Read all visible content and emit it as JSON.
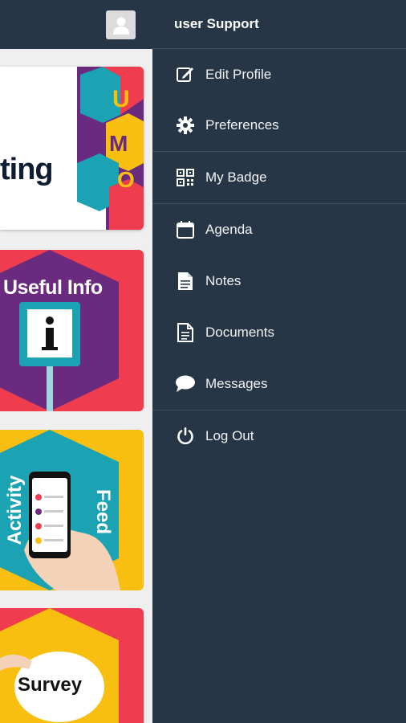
{
  "drawer": {
    "user_name": "user Support",
    "items": [
      {
        "label": "Edit Profile",
        "icon": "edit-icon"
      },
      {
        "label": "Preferences",
        "icon": "gear-icon"
      },
      {
        "label": "My Badge",
        "icon": "qr-code-icon"
      },
      {
        "label": "Agenda",
        "icon": "calendar-icon"
      },
      {
        "label": "Notes",
        "icon": "note-icon"
      },
      {
        "label": "Documents",
        "icon": "document-icon"
      },
      {
        "label": "Messages",
        "icon": "chat-bubble-icon"
      },
      {
        "label": "Log Out",
        "icon": "power-icon"
      }
    ]
  },
  "tiles": {
    "tile1": "ting",
    "tile2": "Useful Info",
    "tile3_left": "Activity",
    "tile3_right": "Feed",
    "tile4": "Survey"
  },
  "colors": {
    "drawer_bg": "#263646",
    "red": "#ef3d4f",
    "yellow": "#f8be10",
    "purple": "#6a2a7e",
    "teal": "#1ba3b4"
  }
}
